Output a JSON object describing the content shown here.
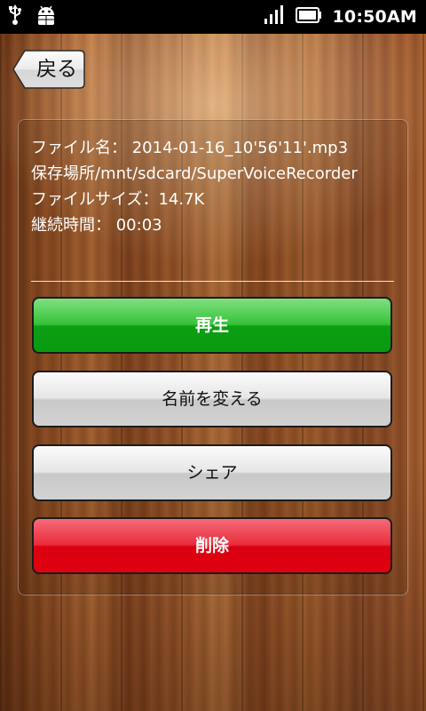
{
  "status_bar": {
    "time": "10:50AM",
    "icons": [
      "usb-icon",
      "android-debug-icon",
      "signal-icon",
      "battery-icon"
    ]
  },
  "header": {
    "back_label": "戻る"
  },
  "file_info": {
    "name_line": "ファイル名： 2014-01-16_10'56'11'.mp3",
    "location_line": "保存場所/mnt/sdcard/SuperVoiceRecorder",
    "size_line": "ファイルサイズ：14.7K",
    "duration_line": "継続時間： 00:03"
  },
  "actions": {
    "play": "再生",
    "rename": "名前を変える",
    "share": "シェア",
    "delete": "削除"
  },
  "colors": {
    "play": "#0fa014",
    "delete": "#e0000f",
    "neutral": "#d2d2d2"
  }
}
